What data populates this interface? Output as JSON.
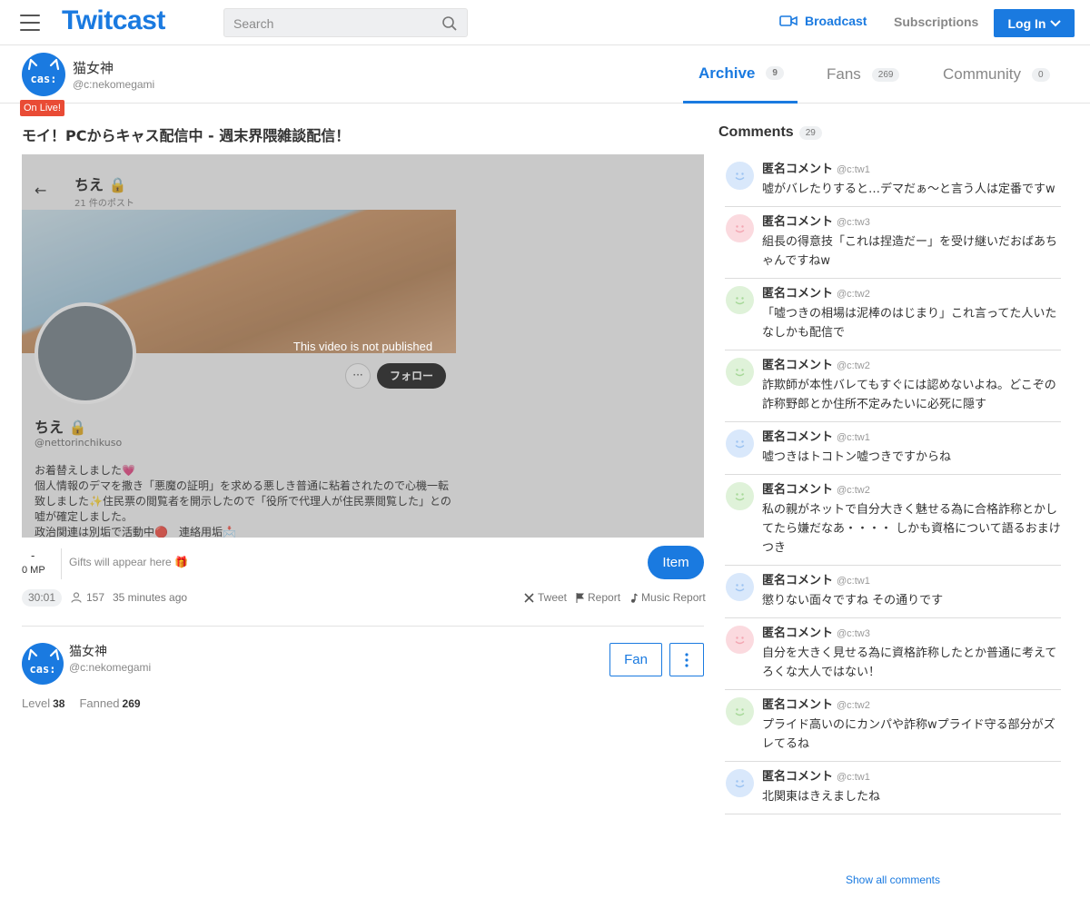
{
  "header": {
    "logo": "Twitcast",
    "search_placeholder": "Search",
    "broadcast": "Broadcast",
    "subscriptions": "Subscriptions",
    "login": "Log In"
  },
  "profile": {
    "avatar_text": "cas:",
    "name": "猫女神",
    "id": "@c:nekomegami",
    "live_badge": "On Live!",
    "tabs": [
      {
        "label": "Archive",
        "count": "9"
      },
      {
        "label": "Fans",
        "count": "269"
      },
      {
        "label": "Community",
        "count": "0"
      }
    ]
  },
  "stream": {
    "title": "モイ！PCからキャス配信中 - 週末界隈雑談配信！",
    "video_message": "This video is not published",
    "screenshot": {
      "back": "←",
      "name": "ちえ 🔒",
      "posts": "21 件のポスト",
      "more": "···",
      "follow": "フォロー",
      "name2": "ちえ 🔒",
      "handle": "@nettorinchikuso",
      "bio": "お着替えしました💗\n個人情報のデマを撒き「悪魔の証明」を求める悪しき普通に粘着されたので心機一転致しました✨住民票の閲覧者を開示したので「役所で代理人が住民票閲覧した」との嘘が確定しました。\n政治関連は別垢で活動中🔴　連絡用垢📩"
    },
    "mp_dash": "-",
    "mp": "0 MP",
    "gifts_placeholder": "Gifts will appear here 🎁",
    "item_button": "Item",
    "duration": "30:01",
    "viewers": "157",
    "time_ago": "35 minutes ago",
    "actions": {
      "tweet": "Tweet",
      "report": "Report",
      "music_report": "Music Report"
    }
  },
  "broadcaster": {
    "avatar_text": "cas:",
    "name": "猫女神",
    "id": "@c:nekomegami",
    "fan_button": "Fan",
    "level_label": "Level",
    "level": "38",
    "fanned_label": "Fanned",
    "fanned": "269"
  },
  "comments": {
    "title": "Comments",
    "count": "29",
    "show_all": "Show all comments",
    "items": [
      {
        "user": "匿名コメント",
        "id": "@c:tw1",
        "color": "blue",
        "text": "嘘がバレたりすると…デマだぁ〜と言う人は定番ですw"
      },
      {
        "user": "匿名コメント",
        "id": "@c:tw3",
        "color": "pink",
        "text": "組長の得意技「これは捏造だー」を受け継いだおばあちゃんですねw"
      },
      {
        "user": "匿名コメント",
        "id": "@c:tw2",
        "color": "green",
        "text": "「嘘つきの相場は泥棒のはじまり」これ言ってた人いたなしかも配信で"
      },
      {
        "user": "匿名コメント",
        "id": "@c:tw2",
        "color": "green",
        "text": "詐欺師が本性バレてもすぐには認めないよね。どこぞの詐称野郎とか住所不定みたいに必死に隠す"
      },
      {
        "user": "匿名コメント",
        "id": "@c:tw1",
        "color": "blue",
        "text": "嘘つきはトコトン嘘つきですからね"
      },
      {
        "user": "匿名コメント",
        "id": "@c:tw2",
        "color": "green",
        "text": "私の親がネットで自分大きく魅せる為に合格詐称とかしてたら嫌だなあ・・・・ しかも資格について語るおまけつき"
      },
      {
        "user": "匿名コメント",
        "id": "@c:tw1",
        "color": "blue",
        "text": "懲りない面々ですね その通りです"
      },
      {
        "user": "匿名コメント",
        "id": "@c:tw3",
        "color": "pink",
        "text": "自分を大きく見せる為に資格詐称したとか普通に考えてろくな大人ではない！"
      },
      {
        "user": "匿名コメント",
        "id": "@c:tw2",
        "color": "green",
        "text": "プライド高いのにカンパや詐称wプライド守る部分がズレてるね"
      },
      {
        "user": "匿名コメント",
        "id": "@c:tw1",
        "color": "blue",
        "text": "北関東はきえましたね"
      }
    ]
  },
  "colors": {
    "accent": "#1a7ae0",
    "live": "#e94b35"
  }
}
